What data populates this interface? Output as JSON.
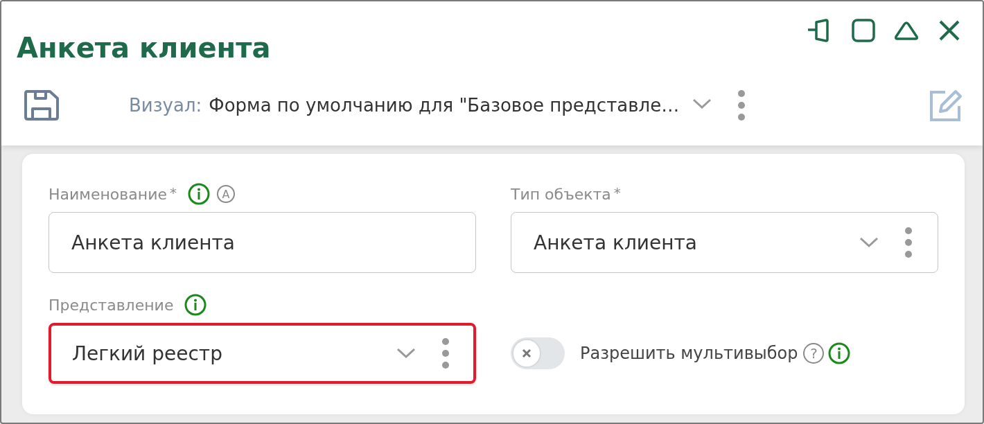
{
  "window": {
    "title": "Анкета клиента"
  },
  "toolbar": {
    "visual_label": "Визуал:",
    "visual_value": "Форма по умолчанию для \"Базовое представле…"
  },
  "fields": [
    {
      "kind": "text",
      "label": "Наименование",
      "required_mark": "*",
      "info": true,
      "auto_badge": "A",
      "value": "Анкета клиента",
      "highlighted": false
    },
    {
      "kind": "select",
      "label": "Тип объекта",
      "required_mark": "*",
      "value": "Анкета клиента",
      "highlighted": false
    },
    {
      "kind": "select",
      "label": "Представление",
      "info": true,
      "value": "Легкий реестр",
      "highlighted": true
    },
    {
      "kind": "toggle",
      "label": "Разрешить мультивыбор",
      "on": false,
      "help": "?",
      "info": true
    }
  ]
}
